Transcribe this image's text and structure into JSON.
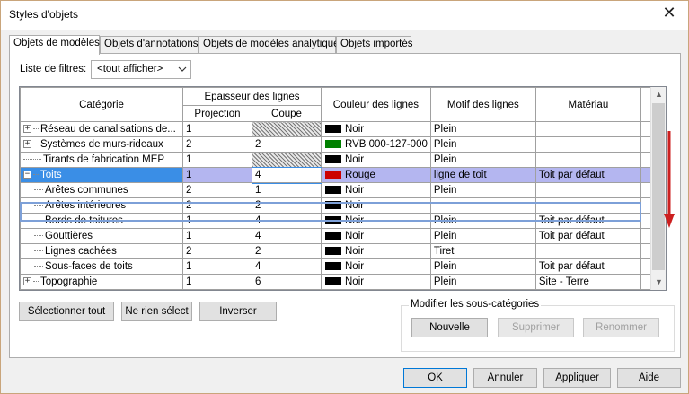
{
  "window": {
    "title": "Styles d'objets",
    "close_glyph": "✕"
  },
  "tabs": [
    {
      "label": "Objets de modèles",
      "active": true
    },
    {
      "label": "Objets d'annotations",
      "active": false
    },
    {
      "label": "Objets de modèles analytiques",
      "active": false
    },
    {
      "label": "Objets importés",
      "active": false
    }
  ],
  "filter": {
    "label": "Liste de filtres:",
    "value": "<tout afficher>"
  },
  "grid": {
    "headers": {
      "category": "Catégorie",
      "line_weight": "Epaisseur des lignes",
      "projection": "Projection",
      "cut": "Coupe",
      "line_color": "Couleur des lignes",
      "line_pattern": "Motif des lignes",
      "material": "Matériau"
    },
    "rows": [
      {
        "category": "Réseau de canalisations de...",
        "level": 0,
        "expander": "+",
        "projection": "1",
        "cut": "",
        "cut_hatched": true,
        "color_name": "Noir",
        "color_hex": "#000000",
        "pattern": "Plein",
        "material": ""
      },
      {
        "category": "Systèmes de murs-rideaux",
        "level": 0,
        "expander": "+",
        "projection": "2",
        "cut": "2",
        "cut_hatched": false,
        "color_name": "RVB 000-127-000",
        "color_hex": "#008000",
        "pattern": "Plein",
        "material": ""
      },
      {
        "category": "Tirants de fabrication MEP",
        "level": 0,
        "expander": "",
        "projection": "1",
        "cut": "",
        "cut_hatched": true,
        "color_name": "Noir",
        "color_hex": "#000000",
        "pattern": "Plein",
        "material": ""
      },
      {
        "category": "Toits",
        "level": 0,
        "expander": "−",
        "projection": "1",
        "cut": "4",
        "cut_hatched": false,
        "color_name": "Rouge",
        "color_hex": "#cc0000",
        "pattern": "ligne de toit",
        "material": "Toit par défaut",
        "selected": true
      },
      {
        "category": "Arêtes communes",
        "level": 1,
        "expander": "",
        "projection": "2",
        "cut": "1",
        "cut_hatched": false,
        "color_name": "Noir",
        "color_hex": "#000000",
        "pattern": "Plein",
        "material": ""
      },
      {
        "category": "Arêtes intérieures",
        "level": 1,
        "expander": "",
        "projection": "2",
        "cut": "2",
        "cut_hatched": false,
        "color_name": "Noir",
        "color_hex": "#000000",
        "pattern": "",
        "material": ""
      },
      {
        "category": "Bords de toitures",
        "level": 1,
        "expander": "",
        "projection": "1",
        "cut": "4",
        "cut_hatched": false,
        "color_name": "Noir",
        "color_hex": "#000000",
        "pattern": "Plein",
        "material": "Toit par défaut"
      },
      {
        "category": "Gouttières",
        "level": 1,
        "expander": "",
        "projection": "1",
        "cut": "4",
        "cut_hatched": false,
        "color_name": "Noir",
        "color_hex": "#000000",
        "pattern": "Plein",
        "material": "Toit par défaut"
      },
      {
        "category": "Lignes cachées",
        "level": 1,
        "expander": "",
        "projection": "2",
        "cut": "2",
        "cut_hatched": false,
        "color_name": "Noir",
        "color_hex": "#000000",
        "pattern": "Tiret",
        "material": ""
      },
      {
        "category": "Sous-faces de toits",
        "level": 1,
        "expander": "",
        "projection": "1",
        "cut": "4",
        "cut_hatched": false,
        "color_name": "Noir",
        "color_hex": "#000000",
        "pattern": "Plein",
        "material": "Toit par défaut"
      },
      {
        "category": "Topographie",
        "level": 0,
        "expander": "+",
        "projection": "1",
        "cut": "6",
        "cut_hatched": false,
        "color_name": "Noir",
        "color_hex": "#000000",
        "pattern": "Plein",
        "material": "Site - Terre"
      }
    ]
  },
  "buttons": {
    "select_all": "Sélectionner tout",
    "select_none": "Ne rien sélect",
    "invert": "Inverser"
  },
  "subcategories": {
    "title": "Modifier les sous-catégories",
    "new": "Nouvelle",
    "delete": "Supprimer",
    "rename": "Renommer"
  },
  "footer": {
    "ok": "OK",
    "cancel": "Annuler",
    "apply": "Appliquer",
    "help": "Aide"
  },
  "colors": {
    "selection_row": "#b4b6f0",
    "selection_cell": "#3a8ee6",
    "annotation_arrow": "#cc1f1f"
  },
  "icons": {
    "scroll_up": "▲",
    "scroll_down": "▼",
    "dropdown": "chevron-down-icon"
  }
}
